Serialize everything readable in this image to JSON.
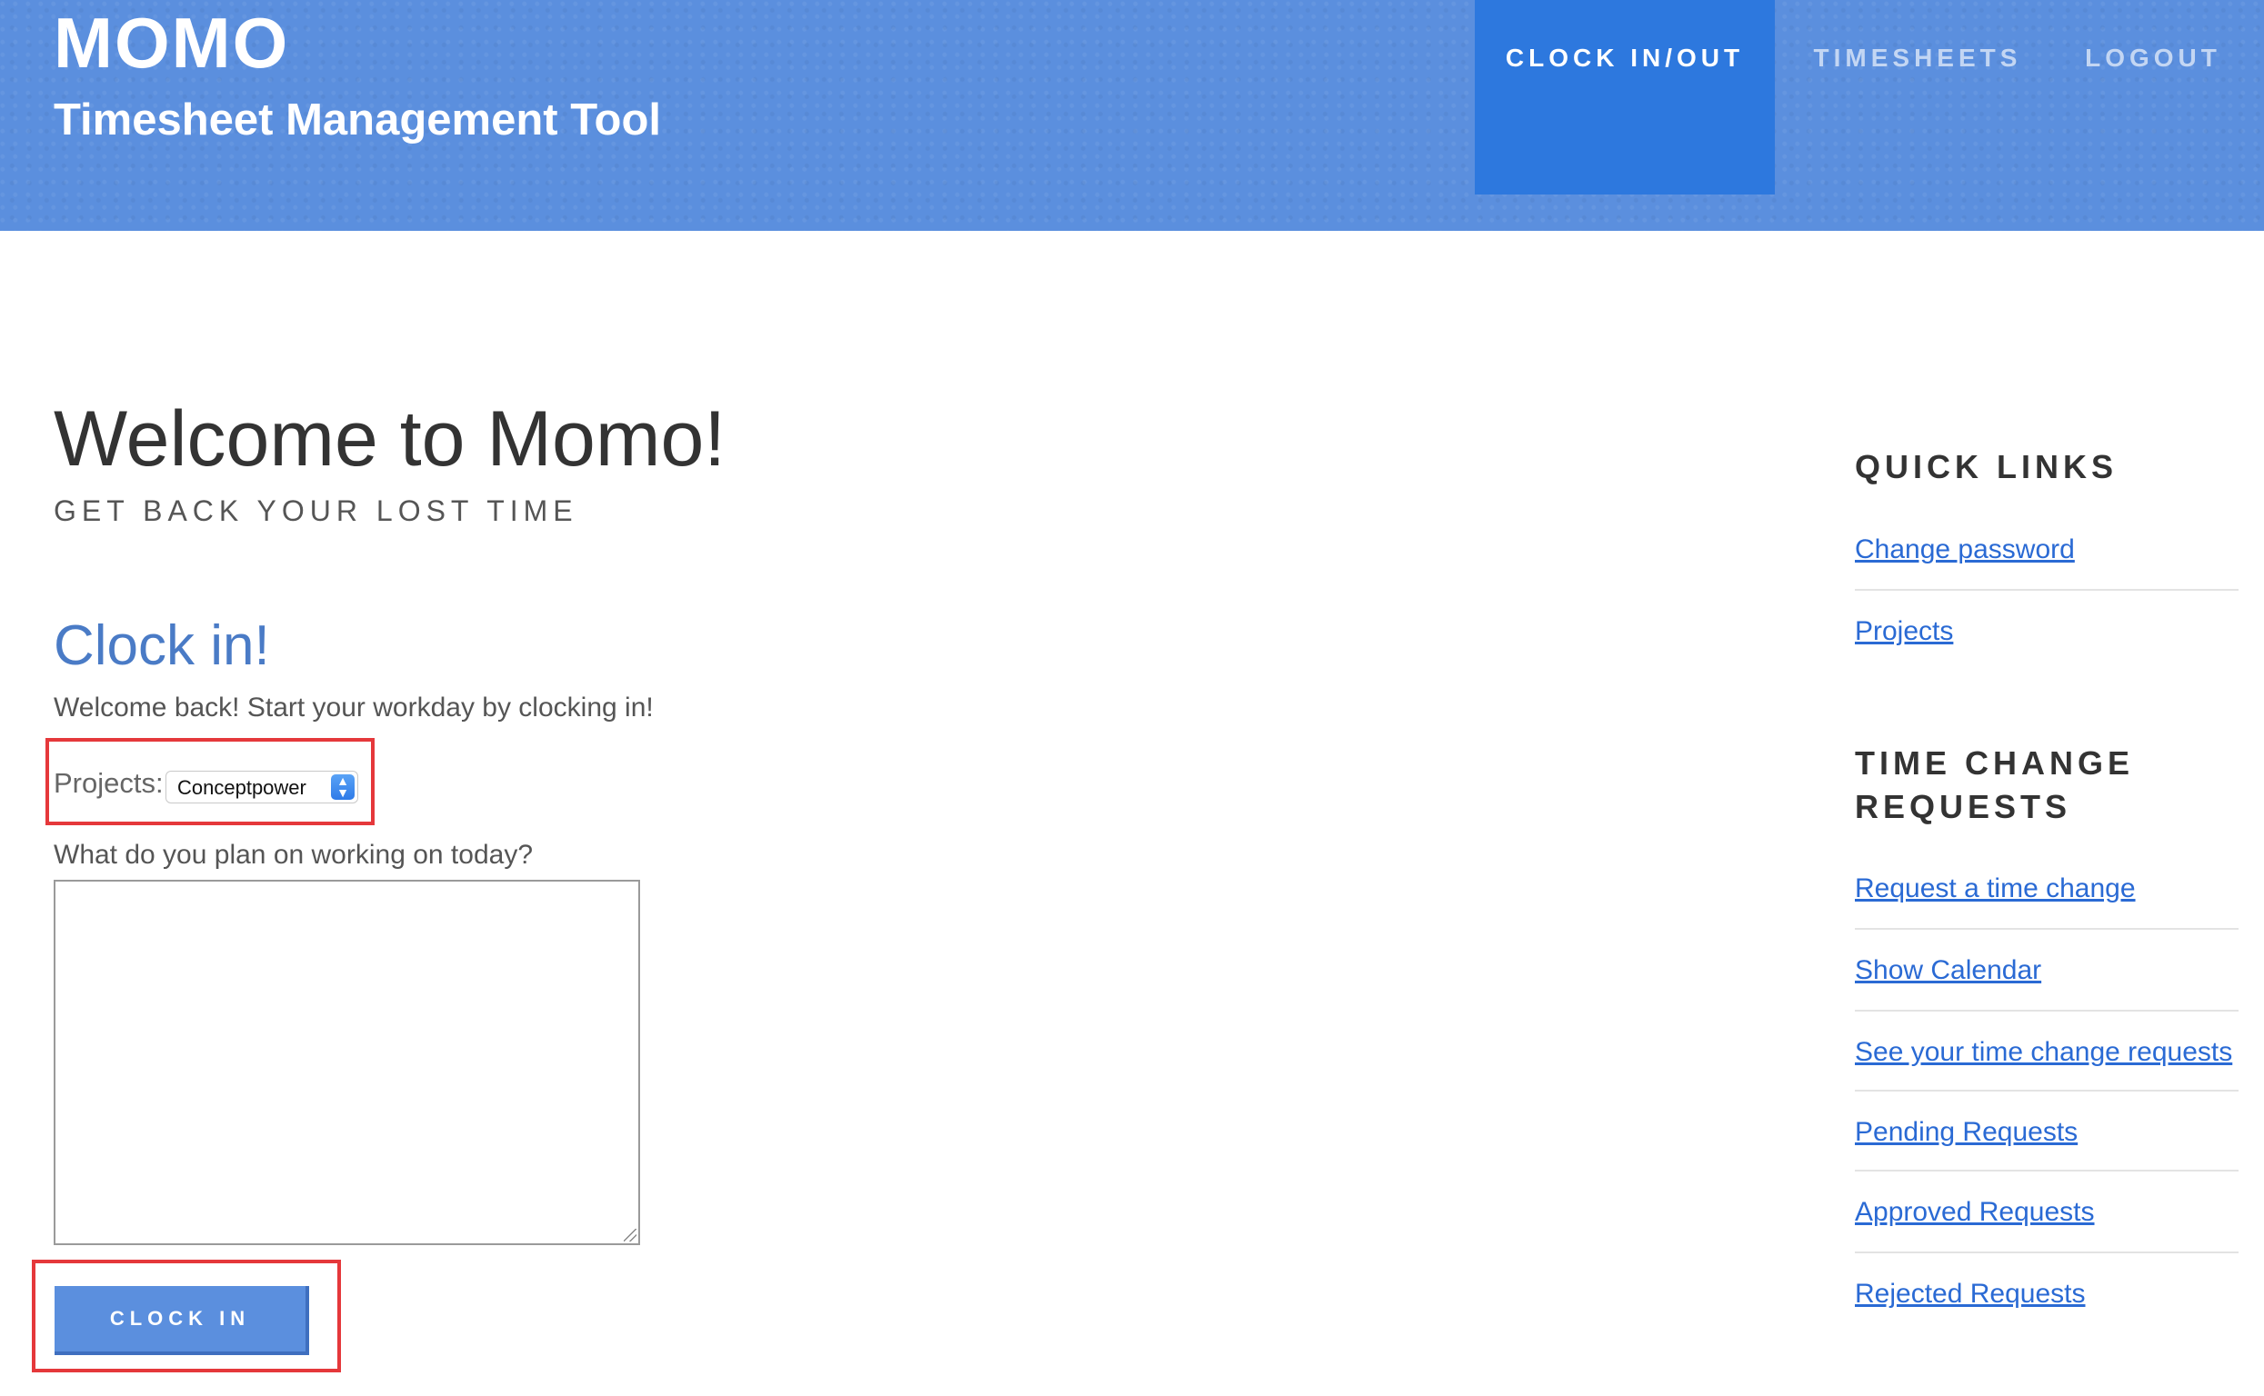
{
  "header": {
    "brand": "MOMO",
    "subtitle": "Timesheet Management Tool",
    "nav": [
      {
        "label": "CLOCK IN/OUT",
        "active": true
      },
      {
        "label": "TIMESHEETS",
        "active": false
      },
      {
        "label": "LOGOUT",
        "active": false
      }
    ]
  },
  "main": {
    "title": "Welcome to Momo!",
    "tagline": "GET BACK YOUR LOST TIME",
    "clock_heading": "Clock in!",
    "welcome_text": "Welcome back! Start your workday by clocking in!",
    "projects_label": "Projects:",
    "project_selected": "Conceptpower",
    "plan_label": "What do you plan on working on today?",
    "plan_value": "",
    "clock_button": "CLOCK IN"
  },
  "sidebar": {
    "quick_links_heading": "QUICK LINKS",
    "quick_links": [
      "Change password",
      "Projects"
    ],
    "tcr_heading_line1": "TIME CHANGE",
    "tcr_heading_line2": "REQUESTS",
    "tcr_links": [
      "Request a time change",
      "Show Calendar",
      "See your time change requests",
      "Pending Requests",
      "Approved Requests",
      "Rejected Requests"
    ]
  },
  "colors": {
    "header_bg": "#5b8fde",
    "nav_active_bg": "#2d78de",
    "link": "#2a6ad4",
    "highlight": "#e5383b"
  }
}
